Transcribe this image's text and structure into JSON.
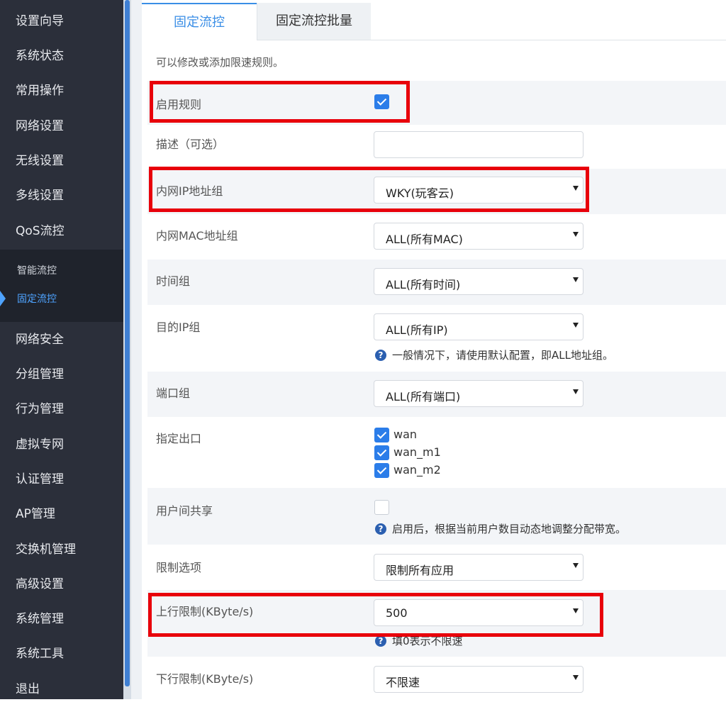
{
  "sidebar": {
    "items": [
      {
        "label": "设置向导"
      },
      {
        "label": "系统状态"
      },
      {
        "label": "常用操作"
      },
      {
        "label": "网络设置"
      },
      {
        "label": "无线设置"
      },
      {
        "label": "多线设置"
      },
      {
        "label": "QoS流控"
      }
    ],
    "submenu": [
      {
        "label": "智能流控"
      },
      {
        "label": "固定流控"
      }
    ],
    "items_after": [
      {
        "label": "网络安全"
      },
      {
        "label": "分组管理"
      },
      {
        "label": "行为管理"
      },
      {
        "label": "虚拟专网"
      },
      {
        "label": "认证管理"
      },
      {
        "label": "AP管理"
      },
      {
        "label": "交换机管理"
      },
      {
        "label": "高级设置"
      },
      {
        "label": "系统管理"
      },
      {
        "label": "系统工具"
      },
      {
        "label": "退出"
      }
    ]
  },
  "tabs": [
    {
      "label": "固定流控"
    },
    {
      "label": "固定流控批量"
    }
  ],
  "hint": "可以修改或添加限速规则。",
  "form": {
    "enable": {
      "label": "启用规则",
      "checked": true
    },
    "description": {
      "label": "描述（可选）",
      "value": ""
    },
    "ip_group": {
      "label": "内网IP地址组",
      "value": "WKY(玩客云)"
    },
    "mac_group": {
      "label": "内网MAC地址组",
      "value": "ALL(所有MAC)"
    },
    "time_group": {
      "label": "时间组",
      "value": "ALL(所有时间)"
    },
    "dest_ip_group": {
      "label": "目的IP组",
      "value": "ALL(所有IP)",
      "help": "一般情况下，请使用默认配置，即ALL地址组。"
    },
    "port_group": {
      "label": "端口组",
      "value": "ALL(所有端口)"
    },
    "outlet": {
      "label": "指定出口",
      "options": [
        {
          "label": "wan",
          "checked": true
        },
        {
          "label": "wan_m1",
          "checked": true
        },
        {
          "label": "wan_m2",
          "checked": true
        }
      ]
    },
    "share": {
      "label": "用户间共享",
      "checked": false,
      "help": "启用后，根据当前用户数目动态地调整分配带宽。"
    },
    "limit_option": {
      "label": "限制选项",
      "value": "限制所有应用"
    },
    "upload": {
      "label": "上行限制(KByte/s)",
      "value": "500",
      "help": "填0表示不限速"
    },
    "download": {
      "label": "下行限制(KByte/s)",
      "value": "不限速"
    }
  },
  "help_glyph": "?",
  "colors": {
    "accent": "#3a8ee6",
    "highlight": "#e8000b",
    "sidebar_bg": "#2b2f3a",
    "checkbox": "#2b7de9"
  }
}
